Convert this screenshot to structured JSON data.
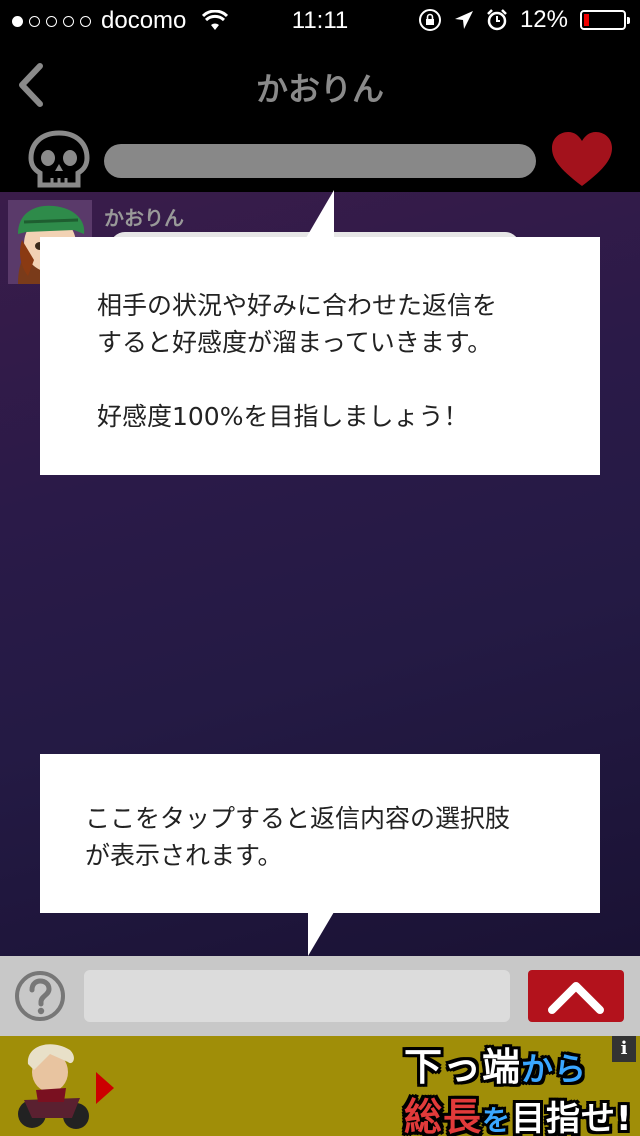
{
  "status": {
    "carrier": "docomo",
    "time": "11:11",
    "battery": "12%",
    "battery_level": 0.12,
    "signal_dots_filled": 1,
    "signal_dots_total": 5,
    "icons": [
      "wifi-icon",
      "rotation-lock-icon",
      "location-icon",
      "alarm-icon"
    ]
  },
  "nav": {
    "title": "かおりん",
    "back_icon": "chevron-left-icon"
  },
  "meter": {
    "left_icon": "skull-icon",
    "right_icon": "heart-icon",
    "affection_level": 0
  },
  "chat": {
    "sender_name": "かおりん"
  },
  "tooltips": {
    "affection_tip_lines": [
      "相手の状況や好みに合わせた返信を",
      "すると好感度が溜まっていきます。"
    ],
    "affection_tip_goal": "好感度100%を目指しましょう！",
    "reply_tip_lines": [
      "ここをタップすると返信内容の選択肢",
      "が表示されます。"
    ]
  },
  "input_bar": {
    "help_icon": "question-circle-icon",
    "send_icon": "chevron-up-icon",
    "input_value": ""
  },
  "ad": {
    "info": "i",
    "line1": [
      "下っ端",
      "から"
    ],
    "line2": [
      "総長",
      "を",
      "目指せ!"
    ]
  },
  "colors": {
    "heart": "#a3121c",
    "send_button": "#b3121c",
    "ad_background": "#a08e08"
  }
}
